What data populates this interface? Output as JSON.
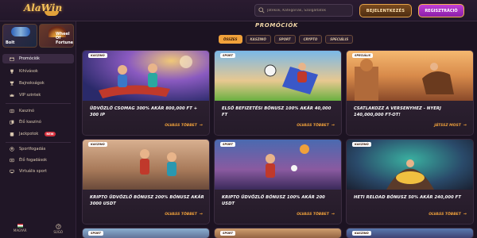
{
  "header": {
    "logo_text": "AlaWin",
    "search_placeholder": "Játékok, Kategóriák, Szolgáltatók",
    "login_label": "BEJELENTKEZÉS",
    "register_label": "REGISZTRÁCIÓ"
  },
  "sidebar": {
    "games": [
      {
        "label": "Bolt"
      },
      {
        "label": "Wheel Of Fortune"
      }
    ],
    "items": [
      {
        "label": "Promóciók",
        "icon": "gift-icon"
      },
      {
        "label": "Kihívások",
        "icon": "trophy-icon"
      },
      {
        "label": "Bajnokságok",
        "icon": "cup-icon"
      },
      {
        "label": "VIP szintek",
        "icon": "crown-icon"
      },
      {
        "label": "Kaszinó",
        "icon": "slot-icon"
      },
      {
        "label": "Élő kaszinó",
        "icon": "dealer-icon"
      },
      {
        "label": "Jackpotok",
        "icon": "coins-icon",
        "badge": "NEW"
      },
      {
        "label": "Sportfogadás",
        "icon": "ball-icon"
      },
      {
        "label": "Élő fogadások",
        "icon": "live-icon"
      },
      {
        "label": "Virtuális sport",
        "icon": "virtual-icon"
      }
    ],
    "footer": {
      "language": "MAGYAR",
      "help": "SÚGÓ"
    }
  },
  "main": {
    "title": "PROMÓCIÓK",
    "tabs": [
      {
        "label": "ÖSSZES",
        "active": true
      },
      {
        "label": "KASZINÓ",
        "active": false
      },
      {
        "label": "SPORT",
        "active": false
      },
      {
        "label": "CRYPTO",
        "active": false
      },
      {
        "label": "SPECIÁLIS",
        "active": false
      }
    ],
    "cards": [
      {
        "badge": "KASZINÓ",
        "title": "ÜDVÖZLŐ CSOMAG 300% AKÁR 800,000 FT + 300 IP",
        "link": "OLVASS TÖBBET"
      },
      {
        "badge": "SPORT",
        "title": "ELSŐ BEFIZETÉSI BÓNUSZ 100% AKÁR 40,000 FT",
        "link": "OLVASS TÖBBET"
      },
      {
        "badge": "SPECIÁLIS",
        "title": "CSATLAKOZZ A VERSENYHEZ - NYERJ 140,000,000 FT-OT!",
        "link": "JÁTSSZ MOST"
      },
      {
        "badge": "KASZINÓ",
        "title": "KRIPTO ÜDVÖZLŐ BÓNUSZ 200% BÓNUSZ AKÁR 3000 USDT",
        "link": "OLVASS TÖBBET"
      },
      {
        "badge": "SPORT",
        "title": "KRIPTO ÜDVÖZLŐ BÓNUSZ 100% AKÁR 200 USDT",
        "link": "OLVASS TÖBBET"
      },
      {
        "badge": "KASZINÓ",
        "title": "HETI RELOAD BÓNUSZ 50% AKÁR 240,000 FT",
        "link": "OLVASS TÖBBET"
      },
      {
        "badge": "SPORT"
      },
      {
        "badge": "SPORT"
      },
      {
        "badge": "KASZINÓ"
      }
    ]
  },
  "colors": {
    "accent": "#f0a13b",
    "register": "#b332cc",
    "background": "#1c1322"
  }
}
